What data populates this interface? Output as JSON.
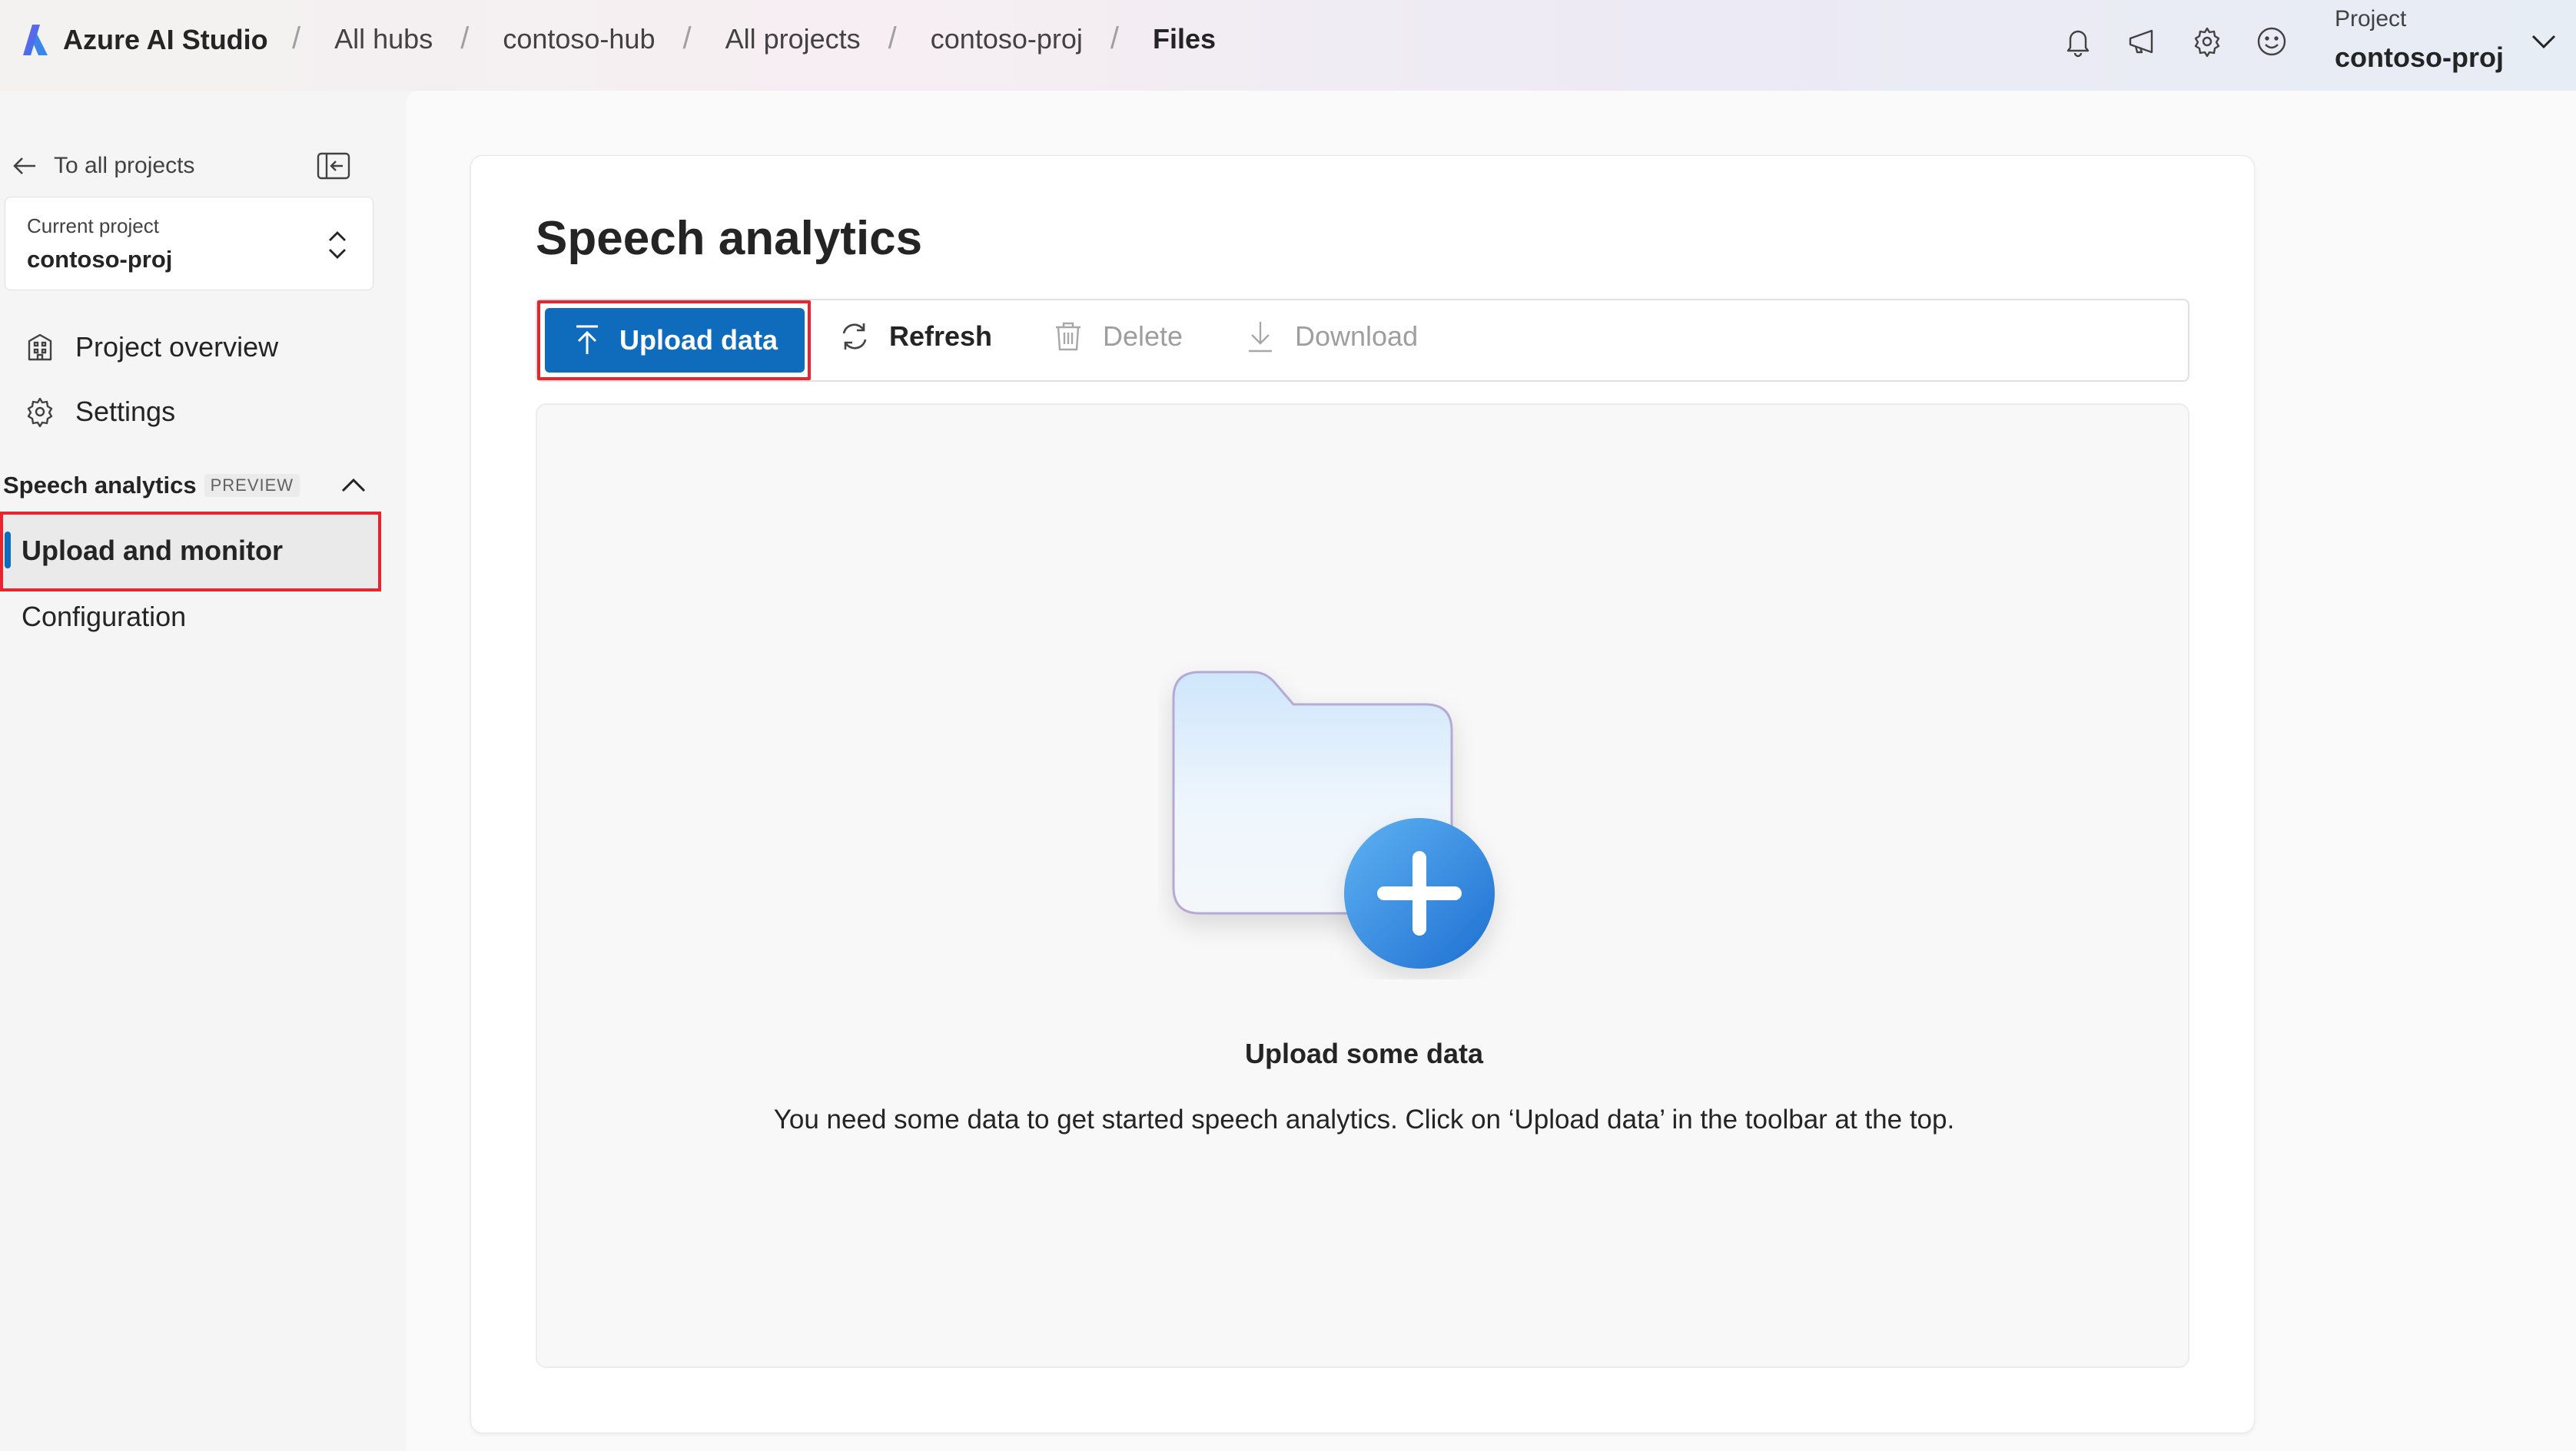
{
  "app": {
    "name": "Azure AI Studio",
    "accent_color": "#0f6cbd",
    "highlight_color": "#e5262e"
  },
  "breadcrumbs": [
    {
      "label": "All hubs"
    },
    {
      "label": "contoso-hub"
    },
    {
      "label": "All projects"
    },
    {
      "label": "contoso-proj"
    },
    {
      "label": "Files"
    }
  ],
  "header": {
    "icons": [
      "bell-icon",
      "megaphone-icon",
      "gear-icon",
      "smiley-icon"
    ],
    "project_label": "Project",
    "project_value": "contoso-proj"
  },
  "sidebar": {
    "back_label": "To all projects",
    "current_project_label": "Current project",
    "current_project_value": "contoso-proj",
    "items": [
      {
        "label": "Project overview",
        "icon": "building-icon"
      },
      {
        "label": "Settings",
        "icon": "gear-icon"
      }
    ],
    "section": {
      "label": "Speech analytics",
      "badge": "PREVIEW",
      "expanded": true,
      "items": [
        {
          "label": "Upload and monitor",
          "active": true
        },
        {
          "label": "Configuration",
          "active": false
        }
      ]
    }
  },
  "main": {
    "title": "Speech analytics",
    "toolbar": {
      "upload": "Upload data",
      "refresh": "Refresh",
      "delete": "Delete",
      "download": "Download"
    },
    "empty_state": {
      "title": "Upload some data",
      "description": "You need some data to get started speech analytics. Click on ‘Upload data’ in the toolbar at the top."
    }
  }
}
